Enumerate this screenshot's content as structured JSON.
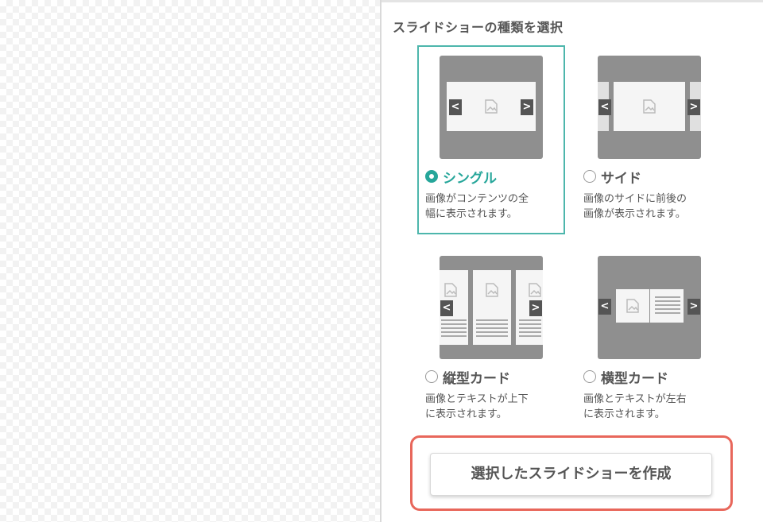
{
  "panel": {
    "title": "スライドショーの種類を選択"
  },
  "options": [
    {
      "label": "シングル",
      "desc_1": "画像がコンテンツの全",
      "desc_2": "幅に表示されます。",
      "selected": true
    },
    {
      "label": "サイド",
      "desc_1": "画像のサイドに前後の",
      "desc_2": "画像が表示されます。",
      "selected": false
    },
    {
      "label": "縦型カード",
      "desc_1": "画像とテキストが上下",
      "desc_2": "に表示されます。",
      "selected": false
    },
    {
      "label": "横型カード",
      "desc_1": "画像とテキストが左右",
      "desc_2": "に表示されます。",
      "selected": false
    }
  ],
  "create_button": {
    "label": "選択したスライドショーを作成"
  },
  "colors": {
    "accent": "#26a69a",
    "selected_border": "#4db6ac",
    "highlight": "#e8675b"
  },
  "icons": {
    "prev": "chevron-left-icon",
    "next": "chevron-right-icon",
    "image": "image-icon"
  }
}
